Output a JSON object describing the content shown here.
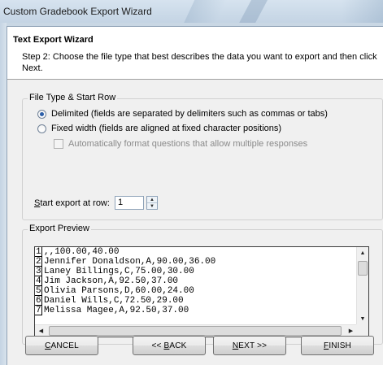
{
  "window": {
    "title": "Custom Gradebook Export Wizard"
  },
  "header": {
    "title": "Text Export Wizard",
    "description": "Step 2: Choose the file type that best describes the data you want to export and then click Next."
  },
  "file_type": {
    "legend": "File Type & Start Row",
    "options": [
      {
        "label": "Delimited (fields are separated by delimiters such as commas or tabs)",
        "checked": true
      },
      {
        "label": "Fixed width (fields are aligned at fixed character positions)",
        "checked": false
      }
    ],
    "auto_format_label": "Automatically format questions that allow multiple responses",
    "auto_format_checked": false,
    "start_row_label_prefix": "S",
    "start_row_label_rest": "tart export at row:",
    "start_row_value": "1"
  },
  "preview": {
    "legend": "Export Preview",
    "lines": [
      {
        "num": "1",
        "text": ",,100.00,40.00"
      },
      {
        "num": "2",
        "text": "Jennifer Donaldson,A,90.00,36.00"
      },
      {
        "num": "3",
        "text": "Laney Billings,C,75.00,30.00"
      },
      {
        "num": "4",
        "text": "Jim Jackson,A,92.50,37.00"
      },
      {
        "num": "5",
        "text": "Olivia Parsons,D,60.00,24.00"
      },
      {
        "num": "6",
        "text": "Daniel Wills,C,72.50,29.00"
      },
      {
        "num": "7",
        "text": "Melissa Magee,A,92.50,37.00"
      }
    ]
  },
  "buttons": {
    "cancel_u": "C",
    "cancel_rest": "ANCEL",
    "back_pre": "<< ",
    "back_u": "B",
    "back_rest": "ACK",
    "next_u": "N",
    "next_rest": "EXT >>",
    "finish_u": "F",
    "finish_rest": "INISH"
  }
}
